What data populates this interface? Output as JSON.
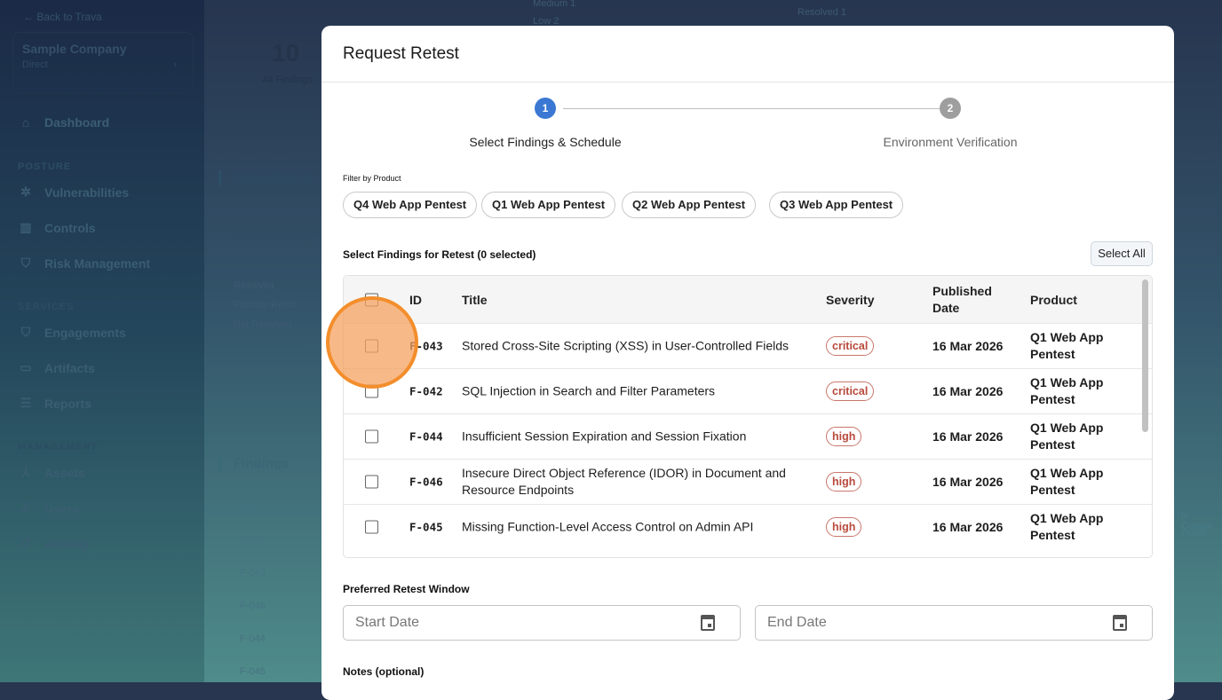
{
  "sidebar": {
    "back": "Back to Trava",
    "company": "Sample Company",
    "company_sub": "Direct",
    "items": [
      {
        "label": "Dashboard",
        "icon": "home-icon"
      },
      {
        "section": "POSTURE"
      },
      {
        "label": "Vulnerabilities",
        "icon": "bug-icon"
      },
      {
        "label": "Controls",
        "icon": "chart-icon"
      },
      {
        "label": "Risk Management",
        "icon": "shield-alert-icon"
      },
      {
        "section": "SERVICES"
      },
      {
        "label": "Engagements",
        "icon": "shield-icon"
      },
      {
        "label": "Artifacts",
        "icon": "folder-icon"
      },
      {
        "label": "Reports",
        "icon": "report-icon"
      },
      {
        "section": "MANAGEMENT"
      },
      {
        "label": "Assets",
        "icon": "assets-icon"
      },
      {
        "label": "Users",
        "icon": "user-icon"
      },
      {
        "label": "Activity",
        "icon": "history-icon"
      }
    ]
  },
  "background": {
    "all_findings_count": "10",
    "all_findings_label": "All Findings",
    "remediation": "Remediation",
    "remediation_progress": "Remediation Pr",
    "legend": [
      "Resolved",
      "Partially Resol",
      "Not Resolved"
    ],
    "findings": "Findings",
    "id_header": "ID",
    "ids": [
      "F-042",
      "F-043",
      "F-046",
      "F-044",
      "F-045"
    ],
    "top_medium": "Medium  1",
    "top_low": "Low  2",
    "top_resolved": "Resolved  1",
    "right_company": "le Compa",
    "right_public": "Public"
  },
  "modal": {
    "title": "Request Retest",
    "steps": [
      {
        "num": "1",
        "label": "Select Findings & Schedule",
        "color": "#3a78d4"
      },
      {
        "num": "2",
        "label": "Environment Verification",
        "color": "#9e9e9e"
      }
    ],
    "filter_label": "Filter by Product",
    "filters": [
      "Q4 Web App Pentest",
      "Q1 Web App Pentest",
      "Q2 Web App Pentest",
      "Q3 Web App Pentest"
    ],
    "select_label": "Select Findings for Retest (0 selected)",
    "select_all": "Select All",
    "columns": [
      "ID",
      "Title",
      "Severity",
      "Published Date",
      "Product"
    ],
    "rows": [
      {
        "id": "F-043",
        "title": "Stored Cross-Site Scripting (XSS) in User-Controlled Fields",
        "severity": "critical",
        "date": "16 Mar 2026",
        "product": "Q1 Web App Pentest",
        "checked": false
      },
      {
        "id": "F-042",
        "title": "SQL Injection in Search and Filter Parameters",
        "severity": "critical",
        "date": "16 Mar 2026",
        "product": "Q1 Web App Pentest",
        "checked": false
      },
      {
        "id": "F-044",
        "title": "Insufficient Session Expiration and Session Fixation",
        "severity": "high",
        "date": "16 Mar 2026",
        "product": "Q1 Web App Pentest",
        "checked": false
      },
      {
        "id": "F-046",
        "title": "Insecure Direct Object Reference (IDOR) in Document and Resource Endpoints",
        "severity": "high",
        "date": "16 Mar 2026",
        "product": "Q1 Web App Pentest",
        "checked": false
      },
      {
        "id": "F-045",
        "title": "Missing Function-Level Access Control on Admin API",
        "severity": "high",
        "date": "16 Mar 2026",
        "product": "Q1 Web App Pentest",
        "checked": false
      }
    ],
    "window_label": "Preferred Retest Window",
    "start_placeholder": "Start Date",
    "end_placeholder": "End Date",
    "notes_label": "Notes (optional)"
  }
}
